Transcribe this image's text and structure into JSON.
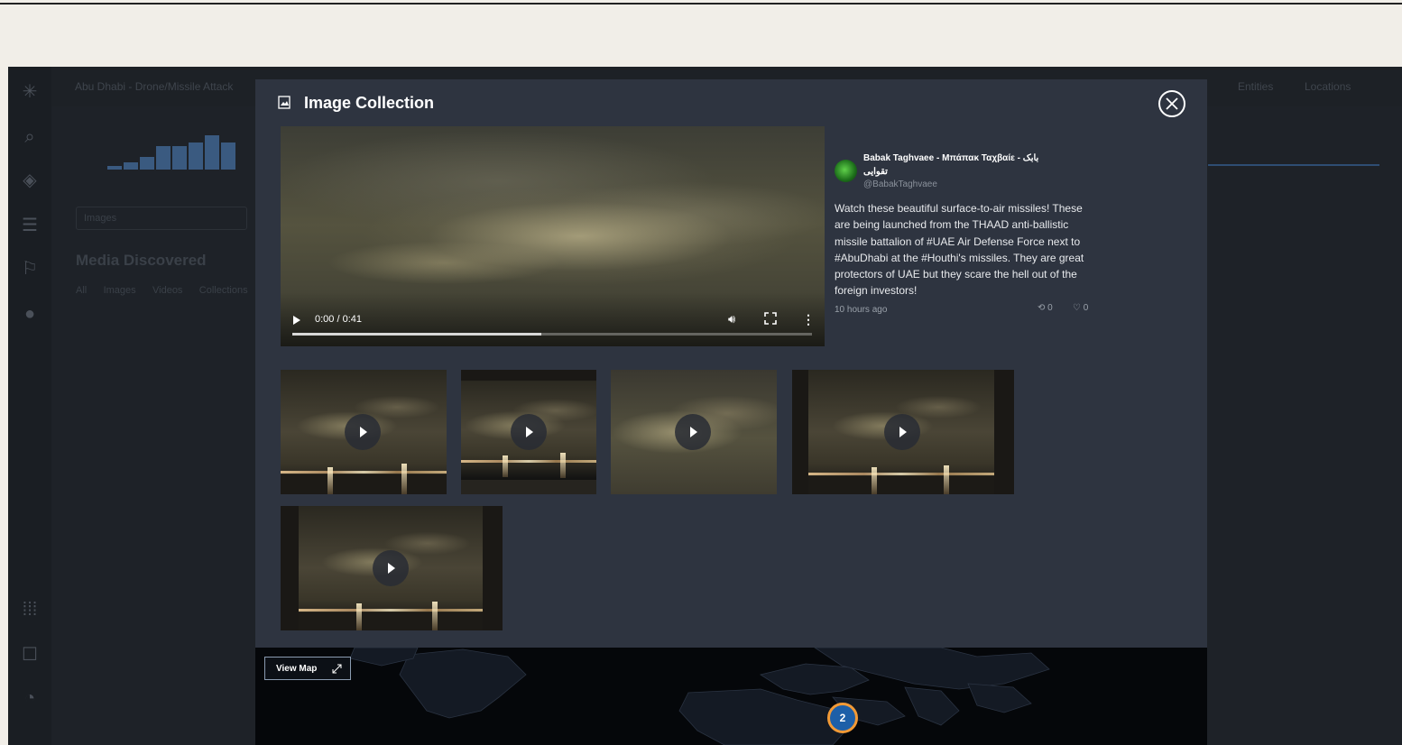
{
  "background_app": {
    "header_title": "Abu Dhabi - Drone/Missile Attack",
    "header_tabs": [
      "Entities",
      "Locations"
    ],
    "section_title": "Media Discovered",
    "filter_tabs": [
      "All",
      "Images",
      "Videos",
      "Collections"
    ],
    "search_placeholder": "Images"
  },
  "modal": {
    "title": "Image Collection",
    "icon": "image-icon",
    "close_icon": "close-icon"
  },
  "video": {
    "time": "0:00 / 0:41",
    "buffered_fraction": 0.48
  },
  "tweet": {
    "name": "Babak Taghvaee - Μπάπακ Ταχβαίε - بابک تقوایی",
    "handle": "@BabakTaghvaee",
    "text": "Watch these beautiful surface-to-air missiles! These are being launched from the THAAD anti-ballistic missile battalion of #UAE Air Defense Force next to #AbuDhabi at the #Houthi's missiles. They are great protectors of UAE but they scare the hell out of the foreign investors!",
    "time": "10 hours ago",
    "retweets": "0",
    "likes": "0"
  },
  "thumbnails_count": 5,
  "map": {
    "view_map_label": "View Map",
    "cluster_count": "2"
  },
  "colors": {
    "modal_bg": "#2e3440",
    "cluster_ring": "#f29a36",
    "cluster_fill": "#1d5fa8"
  }
}
